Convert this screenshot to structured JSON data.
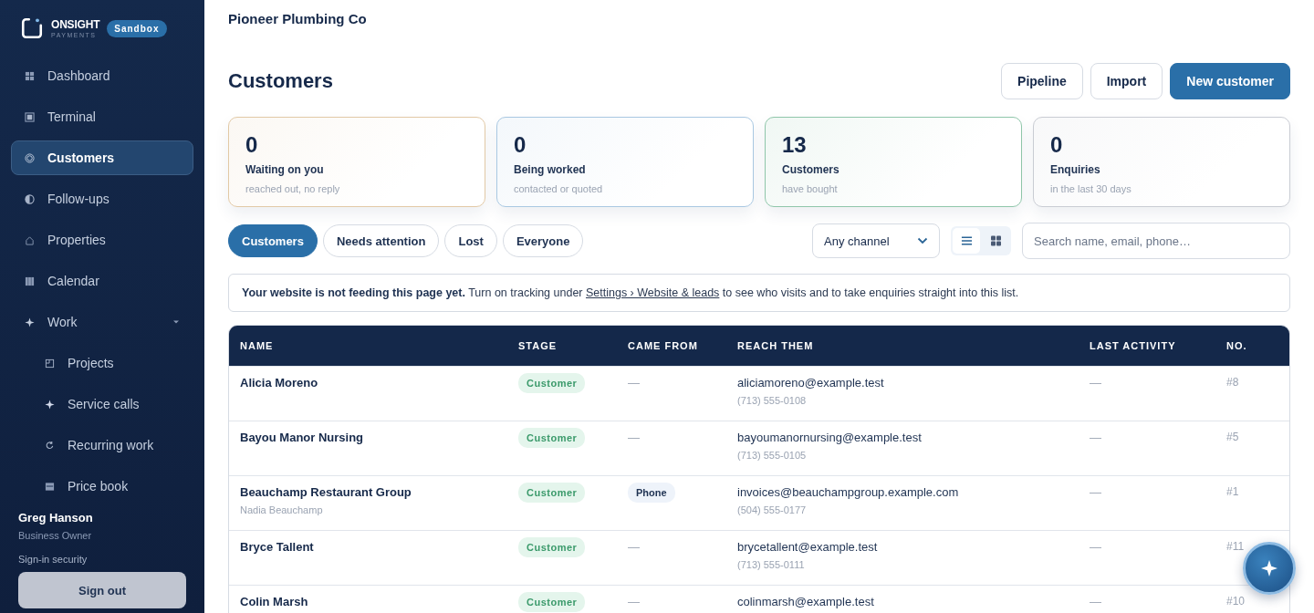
{
  "sidebar": {
    "brand": {
      "name": "ONSIGHT",
      "sub": "PAYMENTS",
      "badge": "Sandbox"
    },
    "items": [
      {
        "label": "Dashboard",
        "selected": false
      },
      {
        "label": "Terminal",
        "selected": false
      },
      {
        "label": "Customers",
        "selected": true
      },
      {
        "label": "Follow-ups",
        "selected": false
      },
      {
        "label": "Properties",
        "selected": false
      },
      {
        "label": "Calendar",
        "selected": false
      },
      {
        "label": "Work",
        "selected": false,
        "expanded": true,
        "children": [
          {
            "label": "Projects",
            "selected": false
          },
          {
            "label": "Service calls",
            "selected": false
          },
          {
            "label": "Recurring work",
            "selected": false
          },
          {
            "label": "Price book",
            "selected": false
          }
        ]
      }
    ],
    "user": {
      "name": "Greg Hanson",
      "role": "Business Owner",
      "security_link": "Sign-in security",
      "sign_out": "Sign out"
    }
  },
  "business": "Pioneer Plumbing Co",
  "page_title": "Customers",
  "actions": [
    {
      "label": "Pipeline",
      "kind": "secondary"
    },
    {
      "label": "Import",
      "kind": "secondary"
    },
    {
      "label": "New customer",
      "kind": "primary"
    }
  ],
  "stats": [
    {
      "value": "0",
      "label": "Waiting on you",
      "note": "reached out, no reply",
      "color": "#e2c9a6"
    },
    {
      "value": "0",
      "label": "Being worked",
      "note": "contacted or quoted",
      "color": "#a9c8e2"
    },
    {
      "value": "13",
      "label": "Customers",
      "note": "have bought",
      "color": "#8fc6aa"
    },
    {
      "value": "0",
      "label": "Enquiries",
      "note": "in the last 30 days",
      "color": "#c9ccd3"
    }
  ],
  "filters": [
    {
      "label": "Customers",
      "selected": true
    },
    {
      "label": "Needs attention",
      "selected": false
    },
    {
      "label": "Lost",
      "selected": false
    },
    {
      "label": "Everyone",
      "selected": false
    }
  ],
  "channel_select": {
    "value": "Any channel"
  },
  "view_toggle": [
    {
      "kind": "list",
      "selected": true
    },
    {
      "kind": "grid",
      "selected": false
    }
  ],
  "search": {
    "placeholder": "Search name, email, phone…"
  },
  "banner": {
    "bold": "Your website is not feeding this page yet.",
    "before": "Turn on tracking under",
    "link": "Settings › Website & leads",
    "after": "to see who visits and to take enquiries straight into this list."
  },
  "table": {
    "columns": [
      "NAME",
      "STAGE",
      "CAME FROM",
      "REACH THEM",
      "LAST ACTIVITY",
      "NO."
    ],
    "rows": [
      {
        "name": "Alicia Moreno",
        "stage": "Customer",
        "came_from": {
          "kind": "dash",
          "text": "—"
        },
        "email": "aliciamoreno@example.test",
        "phone": "(713) 555-0108",
        "last_activity": "—",
        "number": "#8"
      },
      {
        "name": "Bayou Manor Nursing",
        "stage": "Customer",
        "came_from": {
          "kind": "dash",
          "text": "—"
        },
        "email": "bayoumanornursing@example.test",
        "phone": "(713) 555-0105",
        "last_activity": "—",
        "number": "#5"
      },
      {
        "name": "Beauchamp Restaurant Group",
        "contact": "Nadia Beauchamp",
        "stage": "Customer",
        "came_from": {
          "kind": "tag",
          "text": "Phone"
        },
        "email": "invoices@beauchampgroup.example.com",
        "phone": "(504) 555-0177",
        "last_activity": "—",
        "number": "#1"
      },
      {
        "name": "Bryce Tallent",
        "stage": "Customer",
        "came_from": {
          "kind": "dash",
          "text": "—"
        },
        "email": "brycetallent@example.test",
        "phone": "(713) 555-0111",
        "last_activity": "—",
        "number": "#11"
      },
      {
        "name": "Colin Marsh",
        "stage": "Customer",
        "came_from": {
          "kind": "dash",
          "text": "—"
        },
        "email": "colinmarsh@example.test",
        "last_activity": "—",
        "number": "#10"
      }
    ]
  }
}
